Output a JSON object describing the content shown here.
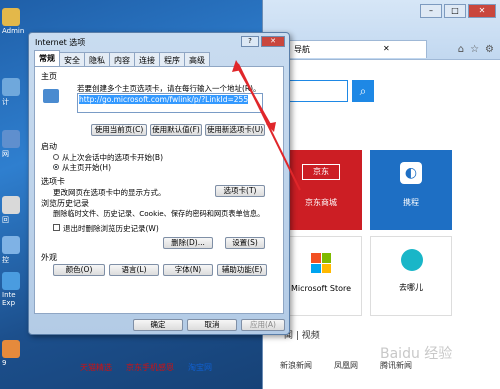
{
  "desktop": {
    "icons": [
      {
        "label": "Admin",
        "color": "#e3b84a"
      },
      {
        "label": "计",
        "color": "#6fa8dc"
      },
      {
        "label": "网",
        "color": "#5f8fce"
      },
      {
        "label": "回",
        "color": "#d9d9d9"
      },
      {
        "label": "控",
        "color": "#7fb2e5"
      },
      {
        "label": "Inte Exp",
        "color": "#4a9ce0"
      },
      {
        "label": "9",
        "color": "#e58a3c"
      }
    ]
  },
  "browser": {
    "tab_title": "导航",
    "search_icon": "search-icon",
    "tiles": [
      {
        "label": "京东商城",
        "logo": "京东",
        "color": "#cc1e24"
      },
      {
        "label": "携程",
        "color": "#1e6fc4"
      },
      {
        "label": "Microsoft Store"
      },
      {
        "label": "去哪儿"
      }
    ],
    "news_header": "闻 | 视频",
    "news_items": [
      "新浪新闻",
      "凤凰网",
      "腾讯新闻"
    ],
    "footer_links": [
      "天猫精选",
      "京东手机感恩",
      "淘宝网"
    ]
  },
  "dialog": {
    "title": "Internet 选项",
    "tabs": [
      "常规",
      "安全",
      "隐私",
      "内容",
      "连接",
      "程序",
      "高级"
    ],
    "home_section": "主页",
    "home_desc": "若要创建多个主页选项卡，请在每行输入一个地址(R)。",
    "home_url": "http://go.microsoft.com/fwlink/p/?LinkId=255",
    "home_buttons": [
      "使用当前页(C)",
      "使用默认值(F)",
      "使用新选项卡(U)"
    ],
    "startup_section": "启动",
    "startup_options": [
      "从上次会话中的选项卡开始(B)",
      "从主页开始(H)"
    ],
    "tabs_section": "选项卡",
    "tabs_desc": "更改网页在选项卡中的显示方式。",
    "tabs_button": "选项卡(T)",
    "history_section": "浏览历史记录",
    "history_desc": "删除临时文件、历史记录、Cookie、保存的密码和网页表单信息。",
    "history_checkbox": "退出时删除浏览历史记录(W)",
    "delete_button": "删除(D)...",
    "settings_button": "设置(S)",
    "appearance_section": "外观",
    "appearance_buttons": [
      "颜色(O)",
      "语言(L)",
      "字体(N)",
      "辅助功能(E)"
    ],
    "ok": "确定",
    "cancel": "取消",
    "apply": "应用(A)"
  },
  "watermark": "元计算",
  "baidu_mark": "Baidu 经验"
}
